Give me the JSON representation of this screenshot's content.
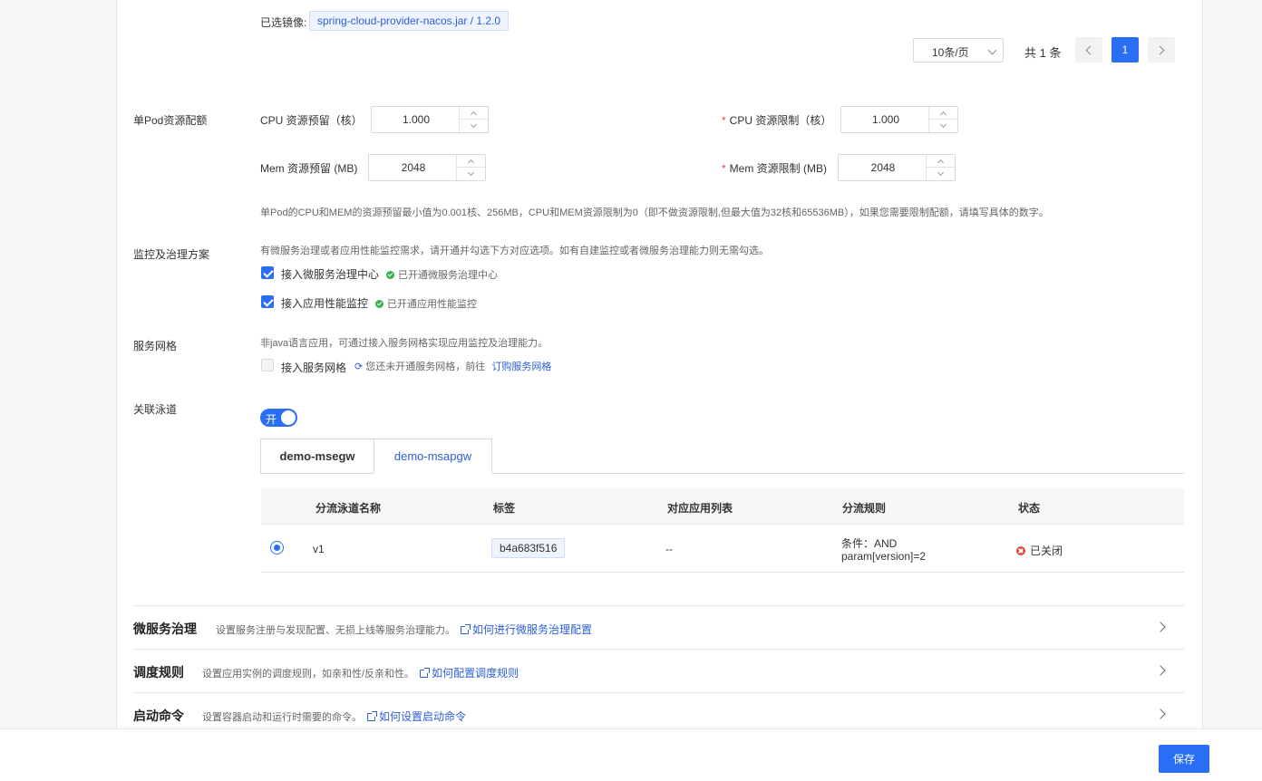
{
  "image": {
    "label": "已选镜像:",
    "value": "spring-cloud-provider-nacos.jar / 1.2.0"
  },
  "pagination": {
    "page_size": "10条/页",
    "total": "共 1 条",
    "current_page": "1"
  },
  "resources": {
    "section_label": "单Pod资源配额",
    "cpu_request_label": "CPU 资源预留（核）",
    "cpu_request_value": "1.000",
    "cpu_limit_label": "CPU 资源限制（核）",
    "cpu_limit_value": "1.000",
    "mem_request_label": "Mem 资源预留 (MB)",
    "mem_request_value": "2048",
    "mem_limit_label": "Mem 资源限制 (MB)",
    "mem_limit_value": "2048",
    "required_mark": "*",
    "hint": "单Pod的CPU和MEM的资源预留最小值为0.001核、256MB，CPU和MEM资源限制为0（即不做资源限制,但最大值为32核和65536MB），如果您需要限制配额，请填写具体的数字。"
  },
  "monitoring": {
    "section_label": "监控及治理方案",
    "hint": "有微服务治理或者应用性能监控需求，请开通并勾选下方对应选项。如有自建监控或者微服务治理能力则无需勾选。",
    "options": [
      {
        "label": "接入微服务治理中心",
        "status": "已开通微服务治理中心",
        "checked": true
      },
      {
        "label": "接入应用性能监控",
        "status": "已开通应用性能监控",
        "checked": true
      }
    ]
  },
  "mesh": {
    "section_label": "服务网格",
    "hint": "非java语言应用，可通过接入服务网格实现应用监控及治理能力。",
    "option_label": "接入服务网格",
    "status_text": "您还未开通服务网格，前往",
    "link": "订购服务网格",
    "checked": false
  },
  "lane": {
    "section_label": "关联泳道",
    "toggle_text": "开",
    "toggle_on": true,
    "tabs": [
      "demo-msegw",
      "demo-msapgw"
    ],
    "active_tab": "demo-msapgw",
    "columns": [
      "分流泳道名称",
      "标签",
      "对应应用列表",
      "分流规则",
      "状态"
    ],
    "rows": [
      {
        "name": "v1",
        "tag": "b4a683f516",
        "apps": "--",
        "rule_line1": "条件：AND",
        "rule_line2": "param[version]=2",
        "status": "已关闭",
        "selected": true
      }
    ]
  },
  "collapsibles": [
    {
      "title": "微服务治理",
      "desc": "设置服务注册与发现配置、无损上线等服务治理能力。",
      "link": "如何进行微服务治理配置"
    },
    {
      "title": "调度规则",
      "desc": "设置应用实例的调度规则，如亲和性/反亲和性。",
      "link": "如何配置调度规则"
    },
    {
      "title": "启动命令",
      "desc": "设置容器启动和运行时需要的命令。",
      "link": "如何设置启动命令"
    }
  ],
  "footer": {
    "save_label": "保存"
  },
  "colors": {
    "primary": "#2a6ef5",
    "success": "#35b34a",
    "danger": "#e54545"
  }
}
